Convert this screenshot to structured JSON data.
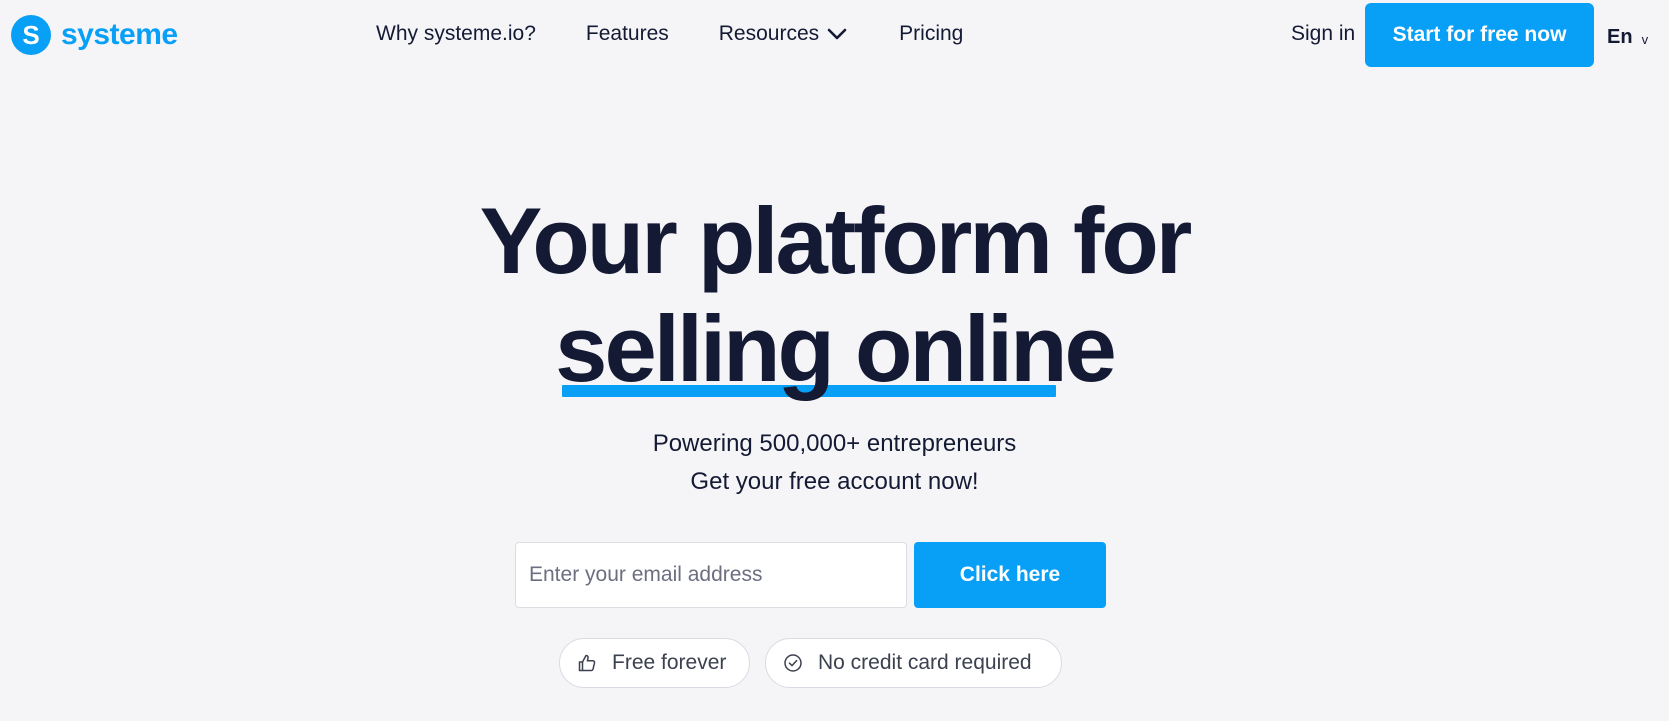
{
  "brand": {
    "logo_letter": "S",
    "name": "systeme",
    "color": "#08a0f6"
  },
  "nav": {
    "items": [
      {
        "label": "Why systeme.io?"
      },
      {
        "label": "Features"
      },
      {
        "label": "Resources",
        "icon": "chevron-down-icon"
      },
      {
        "label": "Pricing"
      }
    ]
  },
  "header": {
    "signin_label": "Sign in",
    "cta_label": "Start for free now",
    "language": "En",
    "language_caret": "v"
  },
  "hero": {
    "title_line1": "Your platform for",
    "title_line2": "selling online",
    "subtitle1": "Powering 500,000+ entrepreneurs",
    "subtitle2": "Get your free account now!"
  },
  "signup": {
    "email_placeholder": "Enter your email address",
    "email_value": "",
    "button_label": "Click here"
  },
  "badges": [
    {
      "label": "Free forever",
      "icon": "thumbs-up-icon"
    },
    {
      "label": "No credit card required",
      "icon": "check-circle-icon"
    }
  ],
  "colors": {
    "accent": "#08a0f6",
    "text": "#141a33",
    "background": "#f5f5f8"
  }
}
